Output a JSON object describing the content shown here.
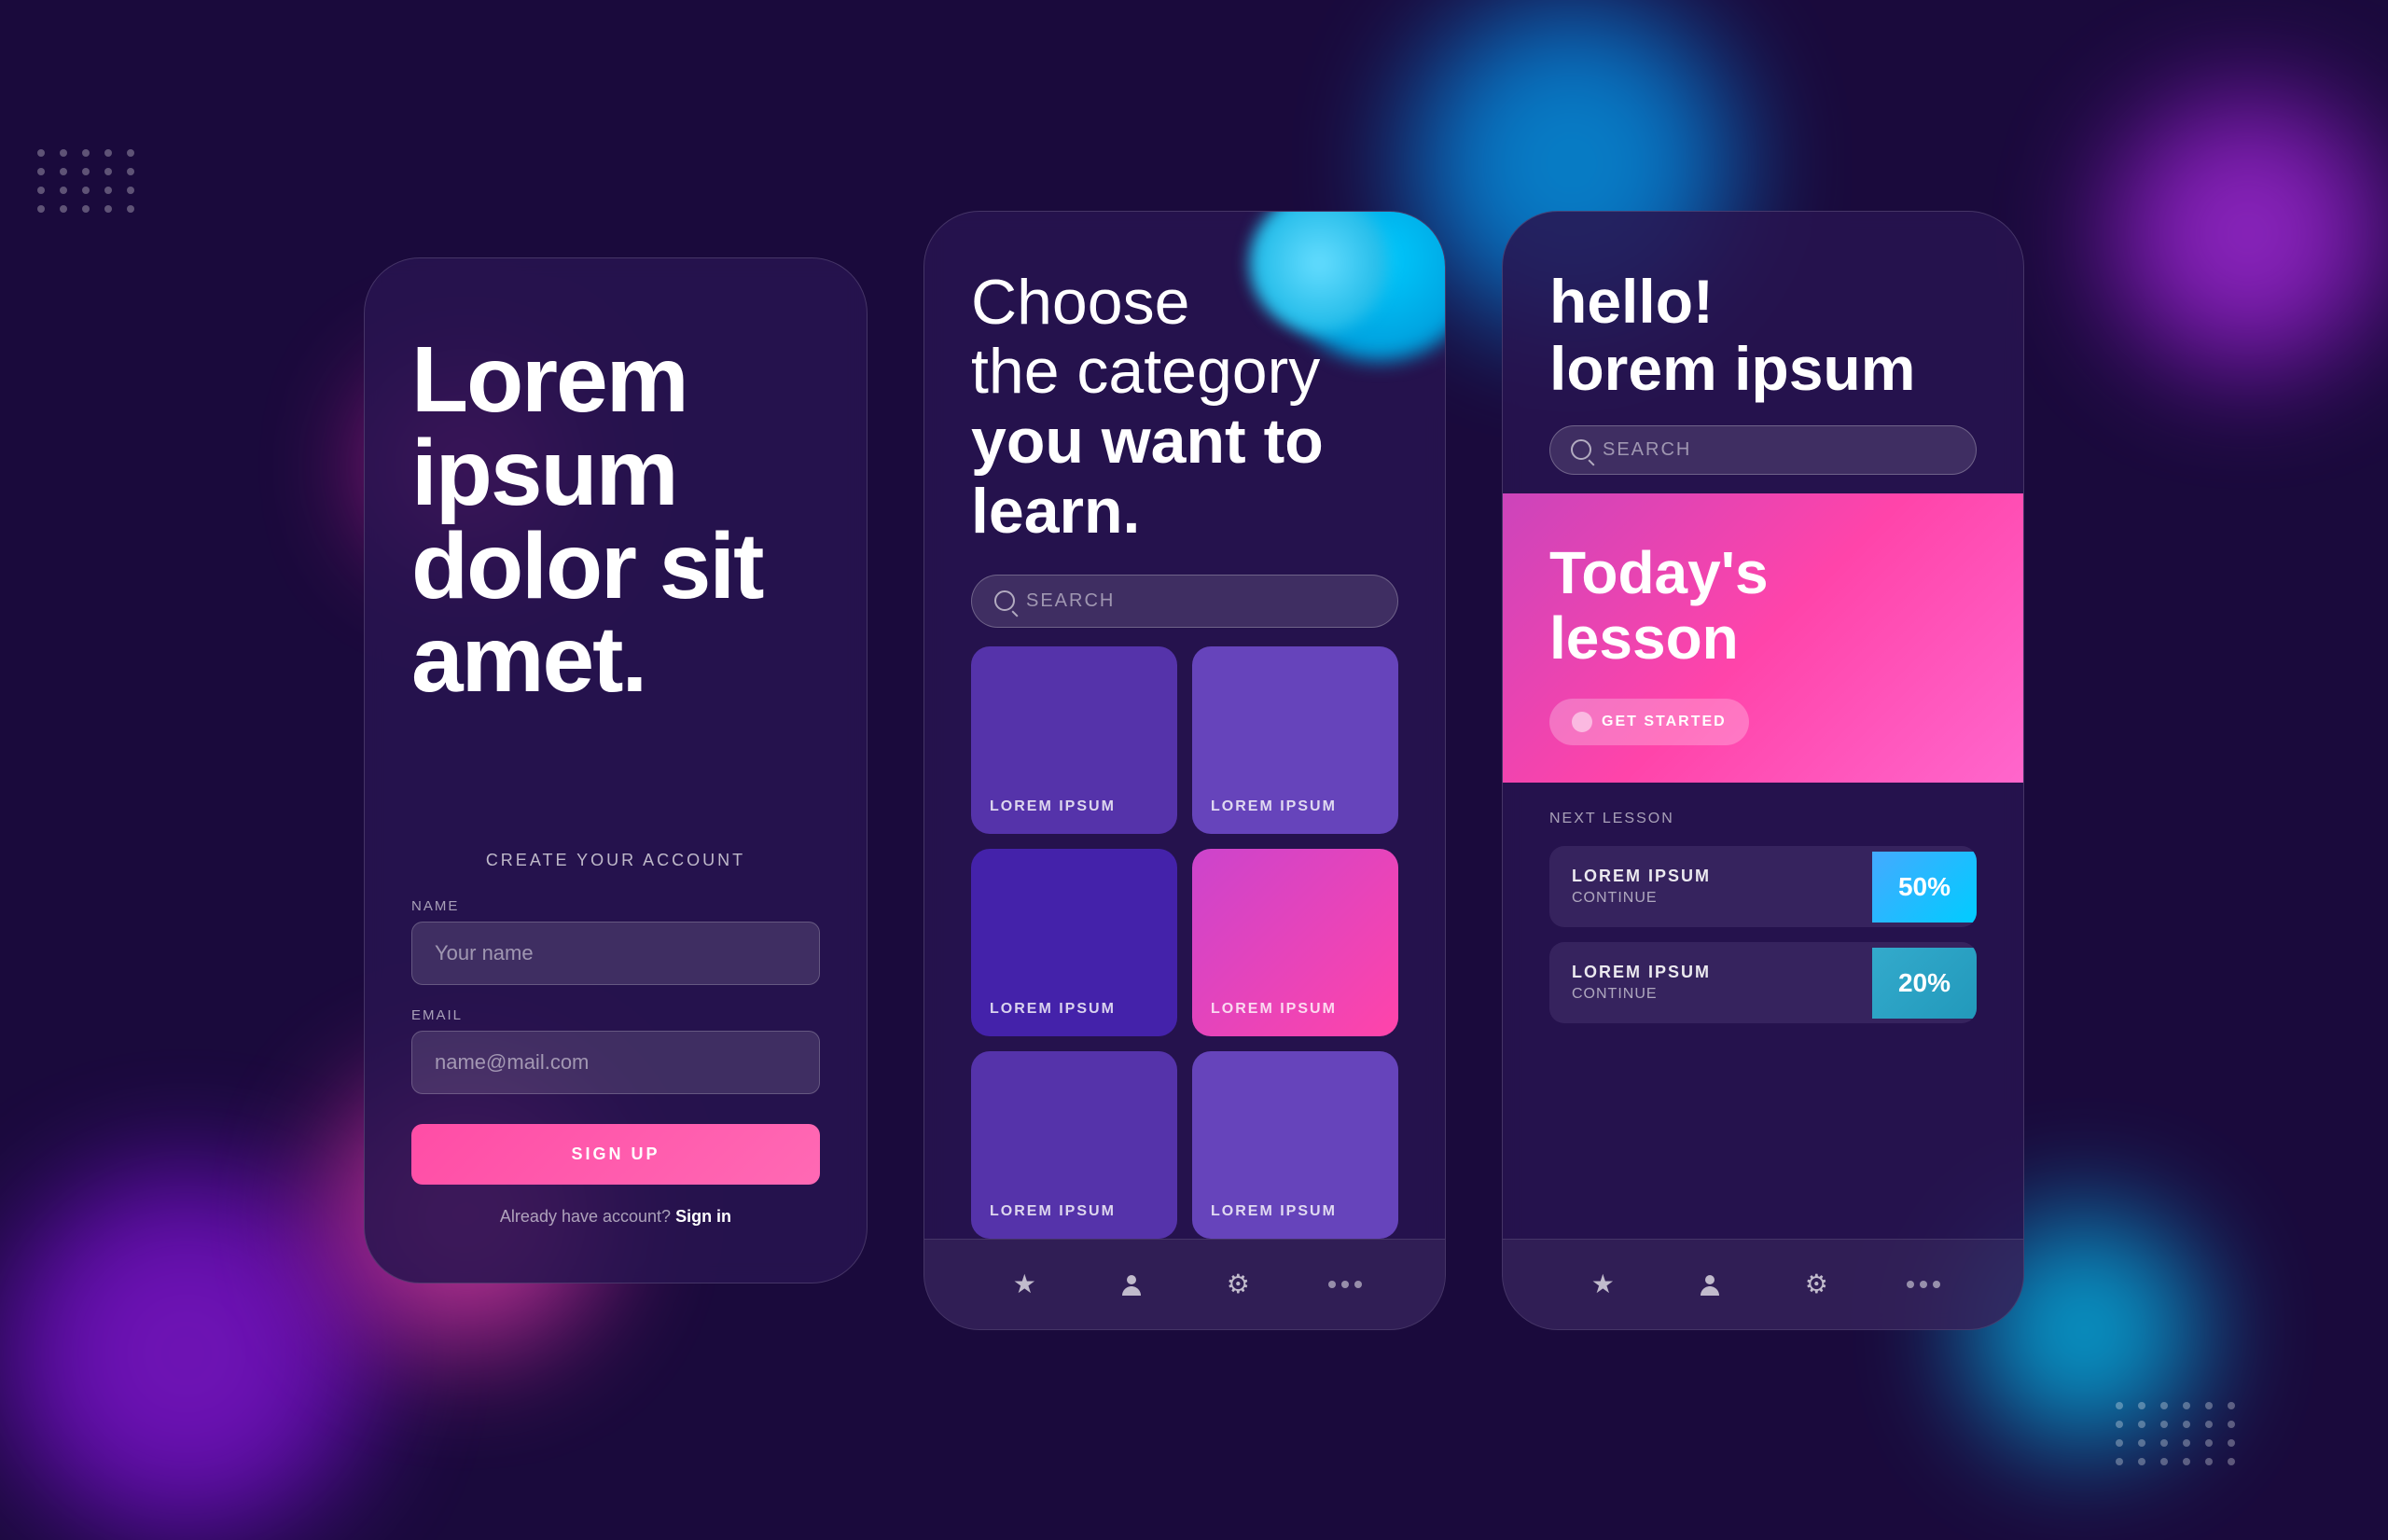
{
  "background": {
    "color": "#1a0a3c"
  },
  "screen1": {
    "title": "Lorem ipsum dolor sit amet.",
    "create_account_label": "CREATE YOUR ACCOUNT",
    "name_label": "NAME",
    "name_placeholder": "Your name",
    "email_label": "EMAIL",
    "email_placeholder": "name@mail.com",
    "sign_up_button": "SIGN UP",
    "signin_text": "Already have account?",
    "signin_link": "Sign in"
  },
  "screen2": {
    "title_line1": "Choose",
    "title_line2": "the category",
    "title_bold": "you want to learn.",
    "search_placeholder": "SEARCH",
    "categories": [
      {
        "label": "LOREM IPSUM",
        "style": "cat-purple-1"
      },
      {
        "label": "LOREM IPSUM",
        "style": "cat-purple-2"
      },
      {
        "label": "LOREM IPSUM",
        "style": "cat-purple-3"
      },
      {
        "label": "LOREM IPSUM",
        "style": "cat-pink"
      },
      {
        "label": "LOREM IPSUM",
        "style": "cat-purple-4"
      },
      {
        "label": "LOREM IPSUM",
        "style": "cat-purple-5"
      }
    ],
    "nav": {
      "star": "★",
      "person": "👤",
      "gear": "⚙",
      "dots": "···"
    }
  },
  "screen3": {
    "greeting": "hello!\nlorem ipsum",
    "search_placeholder": "SEARCH",
    "lesson_title": "Today's\nlesson",
    "get_started": "GET STARTED",
    "next_lesson_label": "NEXT LESSON",
    "lessons": [
      {
        "title": "LOREM IPSUM",
        "sub": "CONTINUE",
        "percent": "50%",
        "style": "lesson-percent"
      },
      {
        "title": "LOREM IPSUM",
        "sub": "CONTINUE",
        "percent": "20%",
        "style": "lesson-percent lesson-percent-2"
      }
    ],
    "nav": {
      "star": "★",
      "person": "👤",
      "gear": "⚙",
      "dots": "···"
    }
  }
}
